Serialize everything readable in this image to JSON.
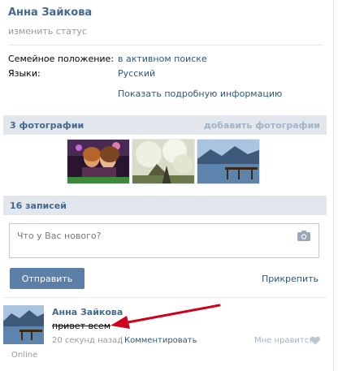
{
  "profile": {
    "name": "Анна Зайкова",
    "status_link": "изменить статус",
    "fields": [
      {
        "label": "Семейное положение:",
        "value": "в активном поиске"
      },
      {
        "label": "Языки:",
        "value": "Русский"
      }
    ],
    "more_info": "Показать подробную информацию"
  },
  "photos": {
    "title": "3 фотографии",
    "add_label": "добавить фотографии"
  },
  "wall": {
    "title": "16 записей",
    "placeholder": "Что у Вас нового?",
    "send_label": "Отправить",
    "attach_label": "Прикрепить"
  },
  "post": {
    "author": "Анна Зайкова",
    "text": "привет всем",
    "time": "20 секунд назад",
    "divider": "|",
    "comment_label": "Комментировать",
    "like_label": "Мне нравится",
    "online": "Online"
  },
  "colors": {
    "link": "#2b587a",
    "header_bg": "#e1e7ed",
    "button": "#5b7fa6",
    "arrow": "#d0021b"
  },
  "icons": {
    "camera": "camera-icon",
    "heart": "heart-icon",
    "arrow": "red-arrow-annotation"
  }
}
